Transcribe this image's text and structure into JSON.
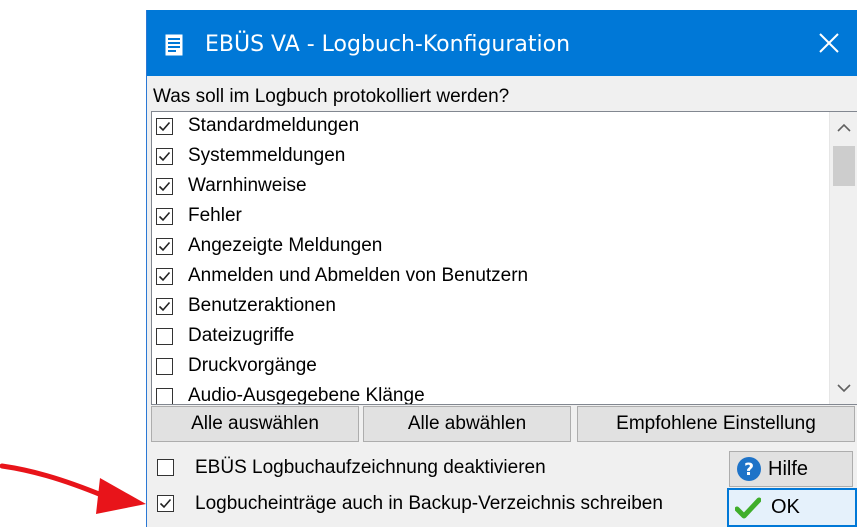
{
  "window": {
    "title": "EBÜS VA - Logbuch-Konfiguration"
  },
  "prompt": "Was soll im Logbuch protokolliert werden?",
  "list_items": [
    {
      "label": "Standardmeldungen",
      "checked": true
    },
    {
      "label": "Systemmeldungen",
      "checked": true
    },
    {
      "label": "Warnhinweise",
      "checked": true
    },
    {
      "label": "Fehler",
      "checked": true
    },
    {
      "label": "Angezeigte Meldungen",
      "checked": true
    },
    {
      "label": "Anmelden und Abmelden von Benutzern",
      "checked": true
    },
    {
      "label": "Benutzeraktionen",
      "checked": true
    },
    {
      "label": "Dateizugriffe",
      "checked": false
    },
    {
      "label": "Druckvorgänge",
      "checked": false
    },
    {
      "label": "Audio-Ausgegebene Klänge",
      "checked": false
    }
  ],
  "buttons": {
    "select_all": "Alle auswählen",
    "deselect_all": "Alle abwählen",
    "recommended": "Empfohlene Einstellung",
    "help": "Hilfe",
    "ok": "OK"
  },
  "options": {
    "disable_logging": {
      "label": "EBÜS Logbuchaufzeichnung deaktivieren",
      "checked": false
    },
    "backup_dir": {
      "label": "Logbucheinträge auch in Backup-Verzeichnis schreiben",
      "checked": true
    }
  },
  "colors": {
    "titlebar": "#0078d7",
    "annotation_arrow": "#e8141a",
    "ok_check": "#3fae2a",
    "help_icon": "#1e73c8"
  }
}
